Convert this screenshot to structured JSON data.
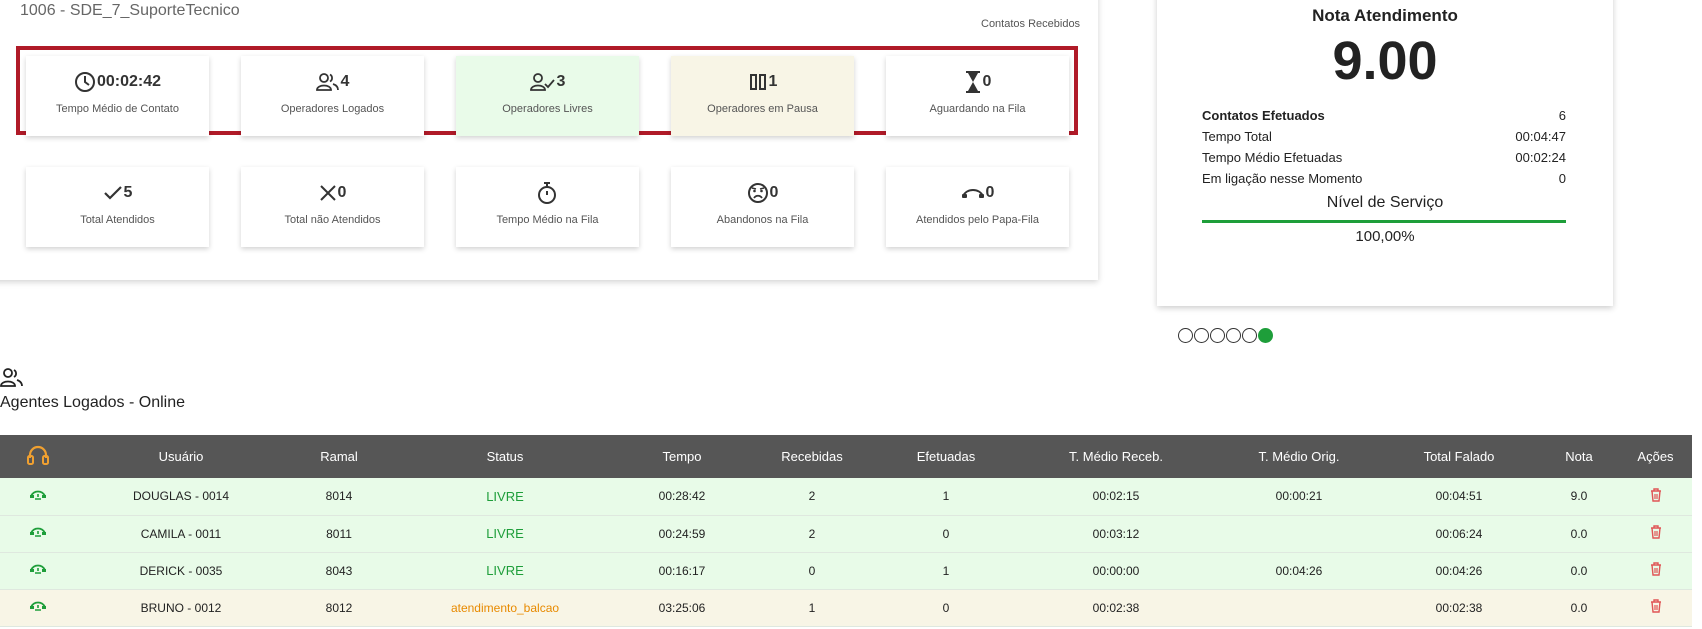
{
  "queue": {
    "title": "1006 - SDE_7_SuporteTecnico",
    "received_label": "Contatos Recebidos"
  },
  "stats_top": [
    {
      "icon": "clock-icon",
      "value": "00:02:42",
      "label": "Tempo Médio de Contato",
      "tone": "white"
    },
    {
      "icon": "users-icon",
      "value": "4",
      "label": "Operadores Logados",
      "tone": "white"
    },
    {
      "icon": "user-check-icon",
      "value": "3",
      "label": "Operadores Livres",
      "tone": "green"
    },
    {
      "icon": "pause-icon",
      "value": "1",
      "label": "Operadores em Pausa",
      "tone": "beige"
    },
    {
      "icon": "hourglass-icon",
      "value": "0",
      "label": "Aguardando na Fila",
      "tone": "white"
    }
  ],
  "stats_bottom": [
    {
      "icon": "check-icon",
      "value": "5",
      "label": "Total Atendidos"
    },
    {
      "icon": "x-icon",
      "value": "0",
      "label": "Total não Atendidos"
    },
    {
      "icon": "stopwatch-icon",
      "value": "",
      "label": "Tempo Médio na Fila"
    },
    {
      "icon": "sad-face-icon",
      "value": "0",
      "label": "Abandonos na Fila"
    },
    {
      "icon": "phone-hangup-icon",
      "value": "0",
      "label": "Atendidos pelo Papa-Fila"
    }
  ],
  "nota": {
    "title": "Nota Atendimento",
    "value": "9.00",
    "rows": [
      {
        "key": "Contatos Efetuados",
        "value": "6"
      },
      {
        "key": "Tempo Total",
        "value": "00:04:47"
      },
      {
        "key": "Tempo Médio Efetuadas",
        "value": "00:02:24"
      },
      {
        "key": "Em ligação nesse Momento",
        "value": "0"
      }
    ],
    "nivel_title": "Nível de Serviço",
    "nivel_value": "100,00%"
  },
  "carousel": {
    "count": 6,
    "active_index": 5
  },
  "agents": {
    "title": "Agentes Logados - Online",
    "columns": [
      "",
      "Usuário",
      "Ramal",
      "Status",
      "Tempo",
      "Recebidas",
      "Efetuadas",
      "T. Médio Receb.",
      "T. Médio Orig.",
      "Total Falado",
      "Nota",
      "Ações"
    ],
    "rows": [
      {
        "user": "DOUGLAS - 0014",
        "ramal": "8014",
        "status": "LIVRE",
        "state": "free",
        "tempo": "00:28:42",
        "recebidas": "2",
        "efetuadas": "1",
        "tmr": "00:02:15",
        "tmo": "00:00:21",
        "total": "00:04:51",
        "nota": "9.0"
      },
      {
        "user": "CAMILA - 0011",
        "ramal": "8011",
        "status": "LIVRE",
        "state": "free",
        "tempo": "00:24:59",
        "recebidas": "2",
        "efetuadas": "0",
        "tmr": "00:03:12",
        "tmo": "",
        "total": "00:06:24",
        "nota": "0.0"
      },
      {
        "user": "DERICK - 0035",
        "ramal": "8043",
        "status": "LIVRE",
        "state": "free",
        "tempo": "00:16:17",
        "recebidas": "0",
        "efetuadas": "1",
        "tmr": "00:00:00",
        "tmo": "00:04:26",
        "total": "00:04:26",
        "nota": "0.0"
      },
      {
        "user": "BRUNO - 0012",
        "ramal": "8012",
        "status": "atendimento_balcao",
        "state": "busy",
        "tempo": "03:25:06",
        "recebidas": "1",
        "efetuadas": "0",
        "tmr": "00:02:38",
        "tmo": "",
        "total": "00:02:38",
        "nota": "0.0"
      }
    ]
  },
  "colors": {
    "accent_green": "#1e9e3a",
    "alert_red": "#b01a28",
    "busy_orange": "#e88a00",
    "delete_red": "#e05555",
    "headset_orange": "#f0a030"
  }
}
